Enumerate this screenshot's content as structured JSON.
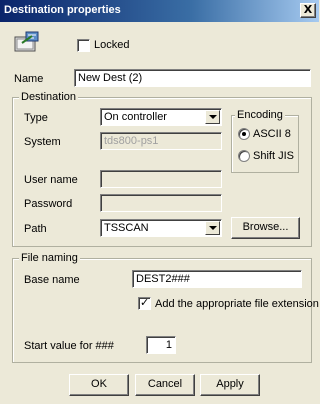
{
  "window": {
    "title": "Destination properties",
    "close_label": "X"
  },
  "top": {
    "locked_label": "Locked",
    "locked_checked": false
  },
  "name": {
    "label": "Name",
    "value": "New Dest (2)"
  },
  "destination": {
    "legend": "Destination",
    "type_label": "Type",
    "type_value": "On controller",
    "system_label": "System",
    "system_value": "tds800-ps1",
    "username_label": "User name",
    "username_value": "",
    "password_label": "Password",
    "password_value": "",
    "path_label": "Path",
    "path_value": "TSSCAN",
    "browse_label": "Browse..."
  },
  "encoding": {
    "legend": "Encoding",
    "options": [
      {
        "label": "ASCII 8",
        "selected": true
      },
      {
        "label": "Shift JIS",
        "selected": false
      }
    ]
  },
  "file_naming": {
    "legend": "File naming",
    "base_label": "Base name",
    "base_value": "DEST2###",
    "ext_label": "Add the appropriate file extension",
    "ext_checked": true,
    "start_label": "Start value for ###",
    "start_value": "1"
  },
  "buttons": {
    "ok": "OK",
    "cancel": "Cancel",
    "apply": "Apply"
  }
}
